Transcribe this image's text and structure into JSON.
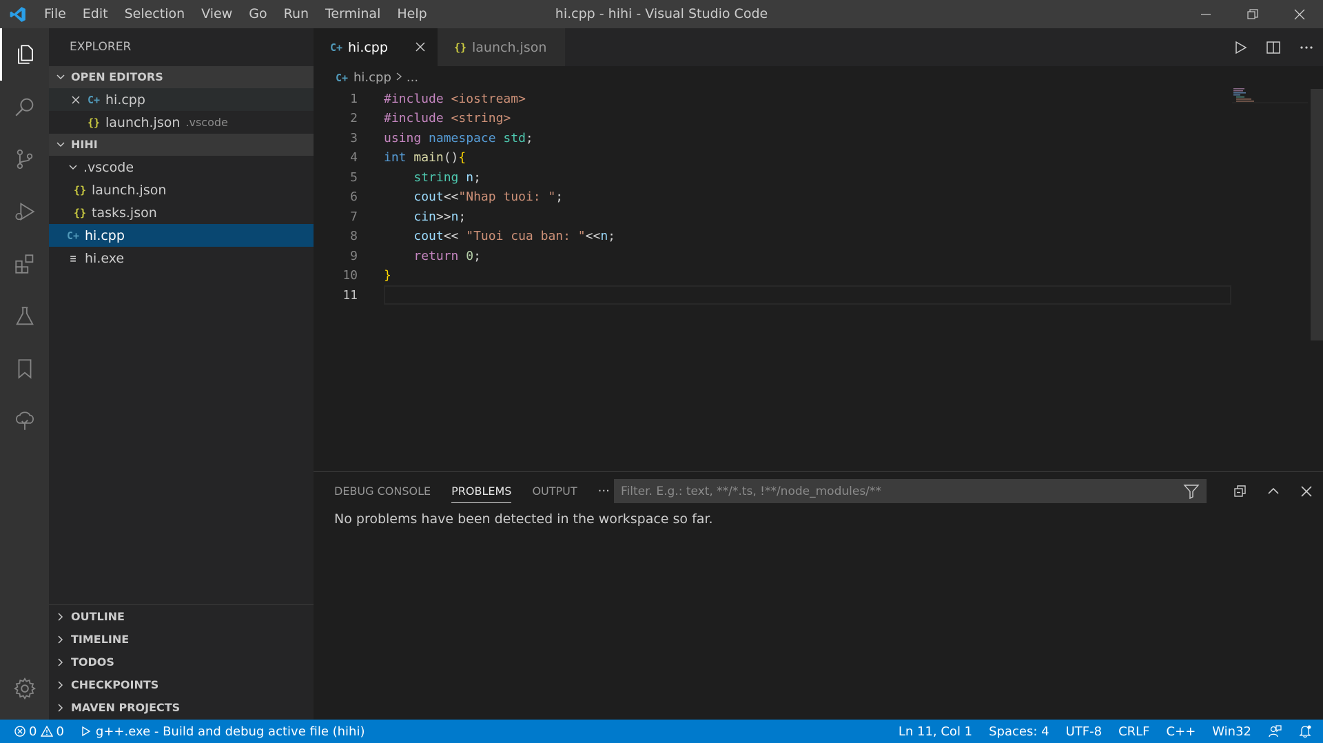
{
  "window": {
    "title": "hi.cpp - hihi - Visual Studio Code",
    "menu": [
      "File",
      "Edit",
      "Selection",
      "View",
      "Go",
      "Run",
      "Terminal",
      "Help"
    ]
  },
  "sidebar": {
    "title": "EXPLORER",
    "open_editors": {
      "header": "OPEN EDITORS",
      "items": [
        {
          "name": "hi.cpp",
          "detail": ""
        },
        {
          "name": "launch.json",
          "detail": ".vscode"
        }
      ]
    },
    "workspace": {
      "header": "HIHI",
      "folder": ".vscode",
      "folder_items": [
        "launch.json",
        "tasks.json"
      ],
      "files": [
        "hi.cpp",
        "hi.exe"
      ]
    },
    "bottom_sections": [
      "OUTLINE",
      "TIMELINE",
      "TODOS",
      "CHECKPOINTS",
      "MAVEN PROJECTS"
    ]
  },
  "editor": {
    "tabs": [
      {
        "label": "hi.cpp",
        "active": true
      },
      {
        "label": "launch.json",
        "active": false
      }
    ],
    "breadcrumb": {
      "file": "hi.cpp",
      "rest": "..."
    },
    "line_numbers": [
      "1",
      "2",
      "3",
      "4",
      "5",
      "6",
      "7",
      "8",
      "9",
      "10",
      "11"
    ],
    "code": {
      "l1a": "#include ",
      "l1b": "<iostream>",
      "l2a": "#include ",
      "l2b": "<string>",
      "l3a": "using ",
      "l3b": "namespace ",
      "l3c": "std",
      "l3d": ";",
      "l4a": "int ",
      "l4b": "main",
      "l4c": "()",
      "l4d": "{",
      "l5a": "    ",
      "l5b": "string ",
      "l5c": "n",
      "l5d": ";",
      "l6a": "    ",
      "l6b": "cout",
      "l6c": "<<",
      "l6d": "\"Nhap tuoi: \"",
      "l6e": ";",
      "l7a": "    ",
      "l7b": "cin",
      "l7c": ">>",
      "l7d": "n",
      "l7e": ";",
      "l8a": "    ",
      "l8b": "cout",
      "l8c": "<< ",
      "l8d": "\"Tuoi cua ban: \"",
      "l8e": "<<",
      "l8f": "n",
      "l8g": ";",
      "l9a": "    ",
      "l9b": "return ",
      "l9c": "0",
      "l9d": ";",
      "l10a": "}"
    }
  },
  "panel": {
    "tabs": [
      "DEBUG CONSOLE",
      "PROBLEMS",
      "OUTPUT"
    ],
    "more": "···",
    "filter_placeholder": "Filter. E.g.: text, **/*.ts, !**/node_modules/**",
    "message": "No problems have been detected in the workspace so far."
  },
  "statusbar": {
    "errors": "0",
    "warnings": "0",
    "launch": "g++.exe - Build and debug active file (hihi)",
    "position": "Ln 11, Col 1",
    "spaces": "Spaces: 4",
    "encoding": "UTF-8",
    "eol": "CRLF",
    "language": "C++",
    "platform": "Win32"
  },
  "colors": {
    "accent": "#007acc",
    "selection": "#094771",
    "titlebar": "#3c3c3c"
  }
}
